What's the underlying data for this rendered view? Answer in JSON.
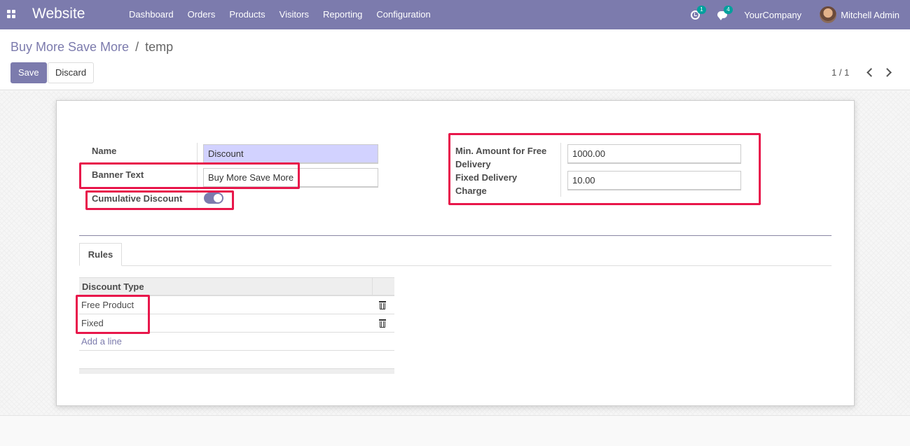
{
  "navbar": {
    "brand": "Website",
    "menu": [
      "Dashboard",
      "Orders",
      "Products",
      "Visitors",
      "Reporting",
      "Configuration"
    ],
    "activity_count": "1",
    "message_count": "4",
    "company": "YourCompany",
    "user": "Mitchell Admin",
    "color": "#7c7bad"
  },
  "breadcrumb": {
    "parent": "Buy More Save More",
    "separator": "/",
    "current": "temp"
  },
  "buttons": {
    "save": "Save",
    "discard": "Discard"
  },
  "pager": "1 / 1",
  "form": {
    "name_label": "Name",
    "name_value": "Discount",
    "banner_label": "Banner Text",
    "banner_value": "Buy More Save More",
    "cumulative_label": "Cumulative Discount",
    "cumulative_on": true,
    "min_amount_label": "Min. Amount for Free Delivery",
    "min_amount_value": "1000.00",
    "fixed_delivery_label": "Fixed Delivery Charge",
    "fixed_delivery_value": "10.00"
  },
  "tabs": [
    {
      "label": "Rules"
    }
  ],
  "rules_table": {
    "header": "Discount Type",
    "rows": [
      {
        "type": "Free Product"
      },
      {
        "type": "Fixed"
      }
    ],
    "add_line": "Add a line"
  },
  "colors": {
    "accent": "#7c7bad",
    "highlight": "#e8174b",
    "required_field": "#d2d2ff"
  }
}
